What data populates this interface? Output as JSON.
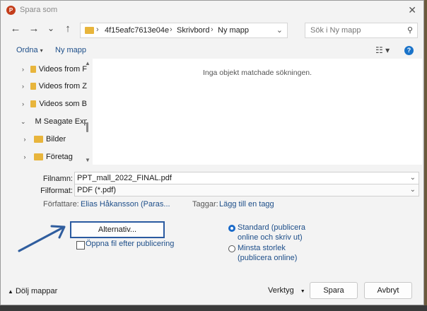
{
  "window": {
    "title": "Spara som",
    "app_icon_letter": "P"
  },
  "nav": {
    "back_icon": "←",
    "forward_icon": "→",
    "recent_icon": "⌄",
    "up_icon": "↑",
    "breadcrumb": [
      "4f15eafc7613e04e",
      "Skrivbord",
      "Ny mapp"
    ],
    "sep": "›",
    "addr_chevron": "⌄",
    "search_placeholder": "Sök i Ny mapp",
    "search_icon": "⚲"
  },
  "commands": {
    "organize": "Ordna",
    "organize_arrow": "▾",
    "new_folder": "Ny mapp",
    "view_icon": "☷ ▾",
    "help": "?"
  },
  "tree": [
    {
      "label": "Videos from F",
      "type": "folder",
      "toggle": "›"
    },
    {
      "label": "Videos from Z",
      "type": "folder",
      "toggle": "›"
    },
    {
      "label": "Videos som B",
      "type": "folder",
      "toggle": "›"
    },
    {
      "label": "M Seagate Exp",
      "type": "drive",
      "toggle": "⌄"
    },
    {
      "label": "Bilder",
      "type": "folder",
      "toggle": "›"
    },
    {
      "label": "Företag",
      "type": "folder",
      "toggle": "›"
    }
  ],
  "scroll": {
    "up": "▲",
    "down": "▼"
  },
  "content": {
    "empty_message": "Inga objekt matchade sökningen."
  },
  "form": {
    "filename_label": "Filnamn:",
    "filename_value": "PPT_mall_2022_FINAL.pdf",
    "format_label": "Filformat:",
    "format_value": "PDF (*.pdf)",
    "chevron": "⌄",
    "authors_label": "Författare:",
    "authors_value": "Elias Håkansson (Paras...",
    "tags_label": "Taggar:",
    "tags_value": "Lägg till en tagg"
  },
  "options": {
    "alternativ_label": "Alternativ...",
    "open_after_label": "Öppna fil efter publicering",
    "radio_standard_line1": "Standard (publicera",
    "radio_standard_line2": "online och skriv ut)",
    "radio_min_line1": "Minsta storlek",
    "radio_min_line2": "(publicera online)"
  },
  "footer": {
    "hide_folders": "Dölj mappar",
    "hide_icon": "▲",
    "tools": "Verktyg",
    "tools_arrow": "▼",
    "save": "Spara",
    "cancel": "Avbryt",
    "close_icon": "✕"
  },
  "colors": {
    "accent": "#2a5aa0",
    "link": "#1d4e89",
    "folder": "#e8b53c",
    "arrow": "#2f5d9e"
  }
}
